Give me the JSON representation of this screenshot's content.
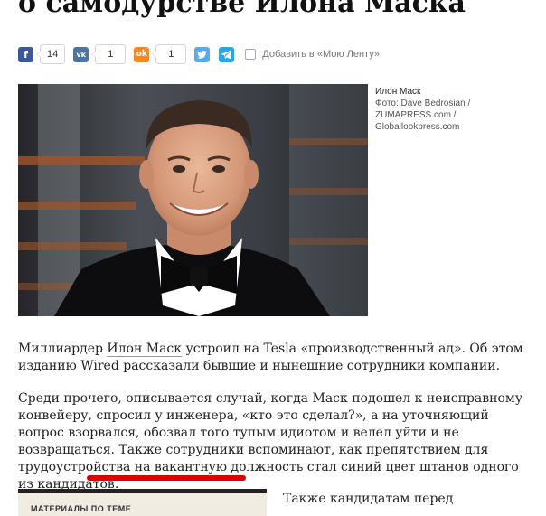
{
  "article": {
    "headline": "о самодурстве Илона Маска"
  },
  "share": {
    "buttons": [
      {
        "name": "facebook",
        "glyph": "f",
        "color": "#3b5998",
        "count": "14"
      },
      {
        "name": "vk",
        "glyph": "vk",
        "color": "#4c75a3",
        "count": "1"
      },
      {
        "name": "odnoklassniki",
        "glyph": "ok",
        "color": "#f0882d",
        "count": "1"
      },
      {
        "name": "twitter",
        "glyph": "t",
        "color": "#55acee"
      },
      {
        "name": "telegram",
        "glyph": "tg",
        "color": "#2ca5e0"
      }
    ],
    "favorite_label": "Добавить в «Мою Ленту»"
  },
  "photo": {
    "caption_name": "Илон Маск",
    "caption_credit_1": "Фото: Dave Bedrosian /",
    "caption_credit_2": "ZUMAPRESS.com /",
    "caption_credit_3": "Globallookpress.com"
  },
  "body": {
    "p1_before": "Миллиардер ",
    "p1_link": "Илон Маск",
    "p1_after": " устроил на Tesla «производственный ад». Об этом изданию Wired рассказали бывшие и нынешние сотрудники компании.",
    "p2": "Среди прочего, описывается случай, когда Маск подошел к неисправному конвейеру, спросил у инженера, «кто это сделал?», а на уточняющий вопрос взорвался, обозвал того тупым идиотом и велел уйти и не возвращаться. Также сотрудники вспоминают, как препятствием для трудоустройства на вакантную должность стал синий цвет штанов одного из кандидатов."
  },
  "related": {
    "label": "МАТЕРИАЛЫ ПО ТЕМЕ"
  },
  "next_text": "Также кандидатам перед"
}
